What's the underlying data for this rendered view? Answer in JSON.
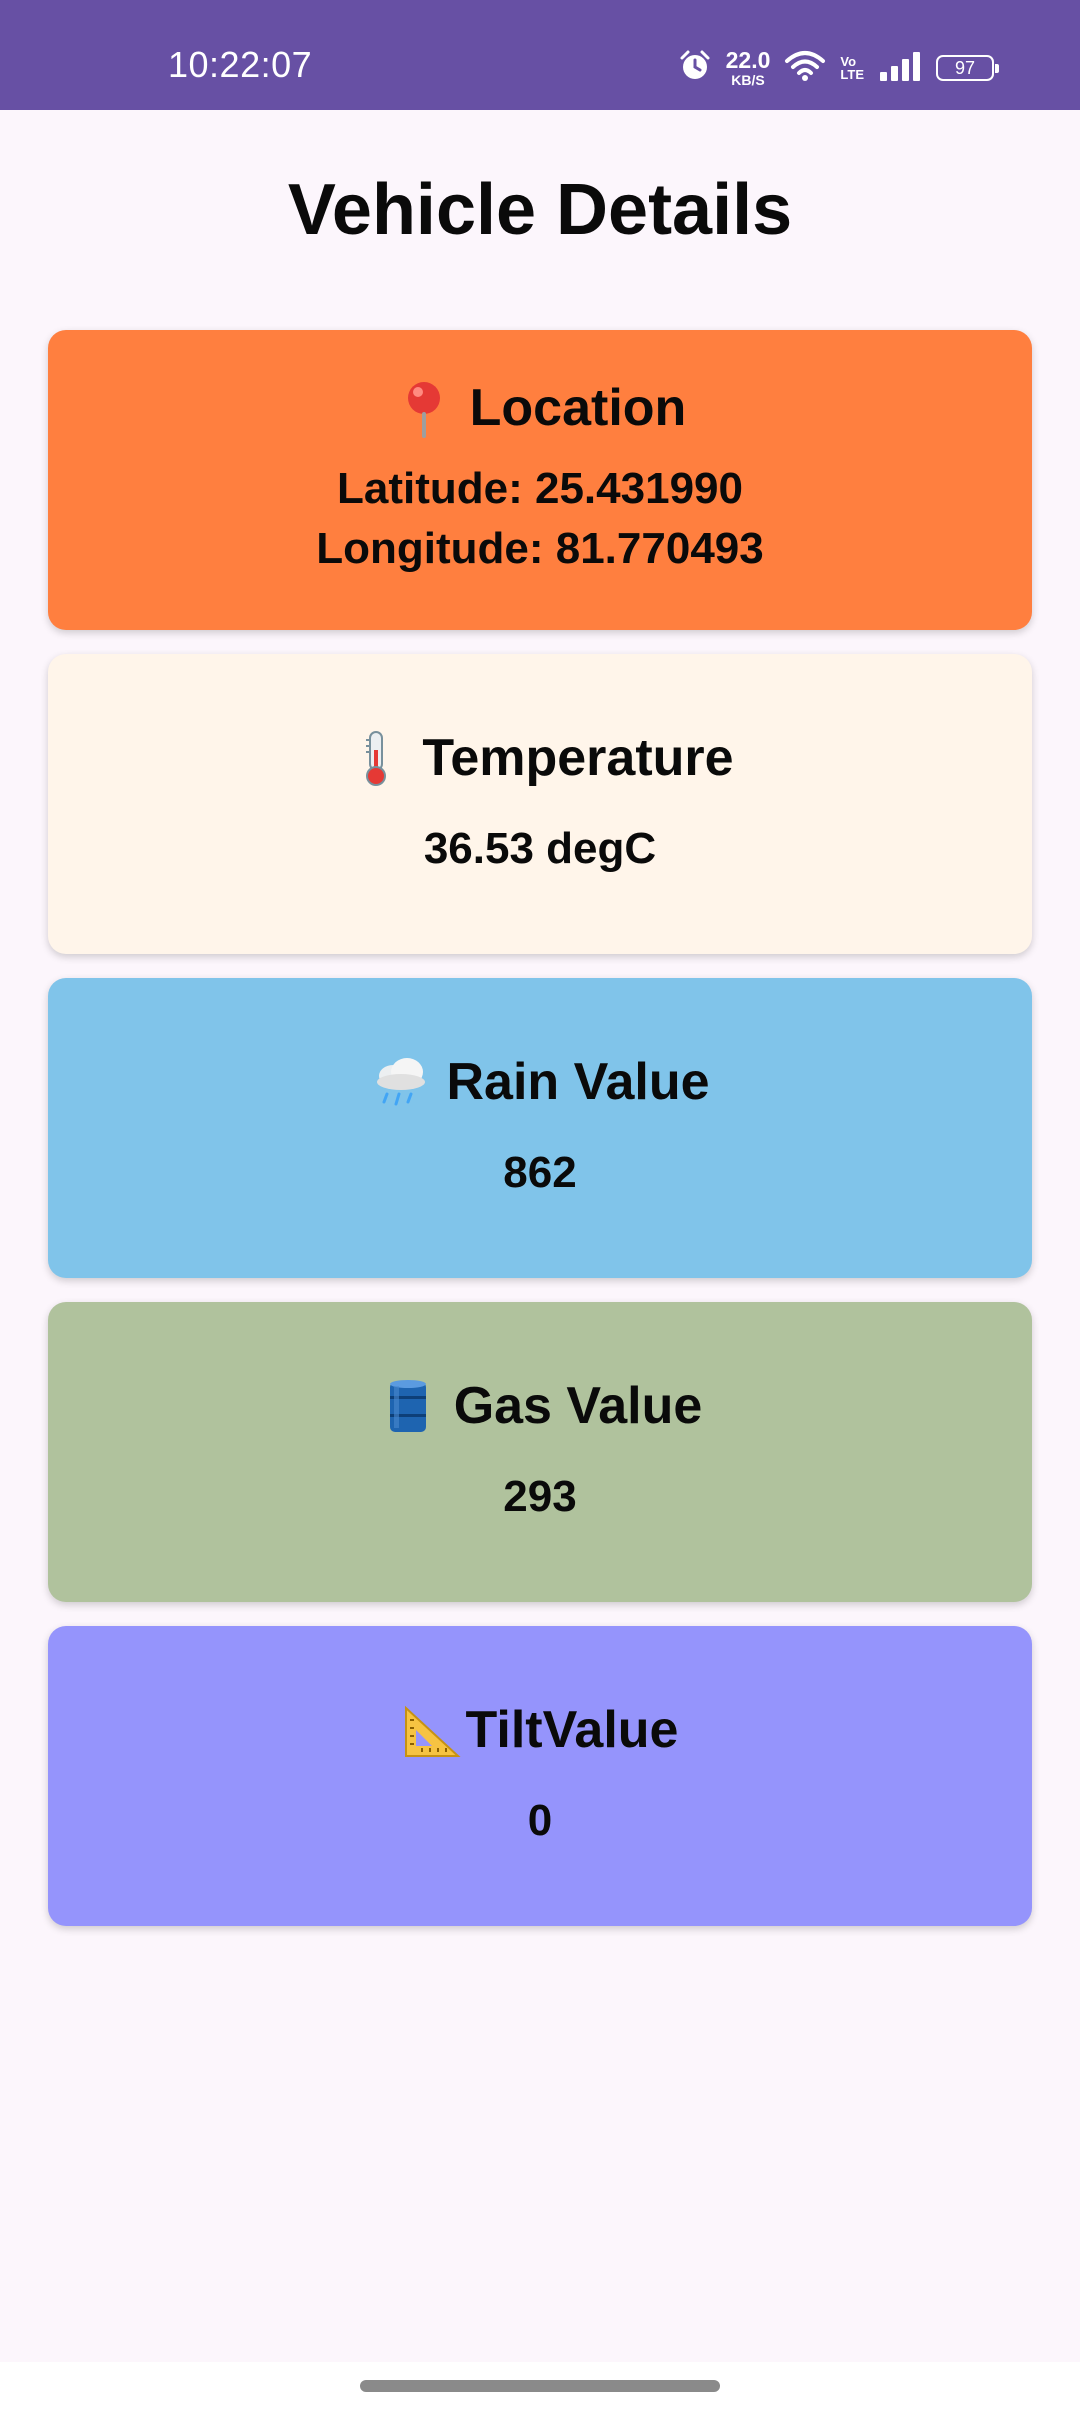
{
  "status_bar": {
    "time": "10:22:07",
    "speed_value": "22.0",
    "speed_unit": "KB/S",
    "volte_top": "Vo",
    "volte_bottom": "LTE",
    "battery": "97",
    "icons": [
      "alarm-icon",
      "wifi-icon",
      "signal-icon",
      "battery-icon"
    ]
  },
  "page": {
    "title": "Vehicle Details"
  },
  "cards": [
    {
      "id": "location",
      "icon": "pin-icon",
      "title": "Location",
      "lines": [
        "Latitude: 25.431990",
        "Longitude: 81.770493"
      ],
      "color": "#FF7F3F"
    },
    {
      "id": "temperature",
      "icon": "thermometer-icon",
      "title": "Temperature",
      "lines": [
        "36.53 degC"
      ],
      "color": "#FFF5EA"
    },
    {
      "id": "rain",
      "icon": "rain-cloud-icon",
      "title": "Rain Value",
      "lines": [
        "862"
      ],
      "color": "#80C4EA"
    },
    {
      "id": "gas",
      "icon": "oil-drum-icon",
      "title": "Gas Value",
      "lines": [
        "293"
      ],
      "color": "#B0C29D"
    },
    {
      "id": "tilt",
      "icon": "triangular-ruler-icon",
      "title": "TiltValue",
      "lines": [
        "0"
      ],
      "color": "#9594FC"
    }
  ],
  "colors": {
    "status_bar": "#6750A4",
    "background": "#FCF6FC"
  }
}
